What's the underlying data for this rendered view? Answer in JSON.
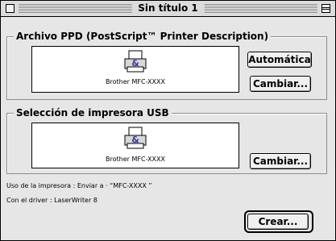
{
  "window": {
    "title": "Sin título 1"
  },
  "ppd_section": {
    "title": "Archivo PPD (PostScript™ Printer Description)",
    "printer_label": "Brother MFC-XXXX",
    "auto_button": "Automática",
    "change_button": "Cambiar..."
  },
  "usb_section": {
    "title": "Selección de impresora USB",
    "printer_label": "Brother MFC-XXXX",
    "change_button": "Cambiar..."
  },
  "info": {
    "usage": "Uso de la impresora : Enviar a · “MFC-XXXX ”",
    "driver": "Con el driver : LaserWriter 8"
  },
  "create_button": "Crear..."
}
